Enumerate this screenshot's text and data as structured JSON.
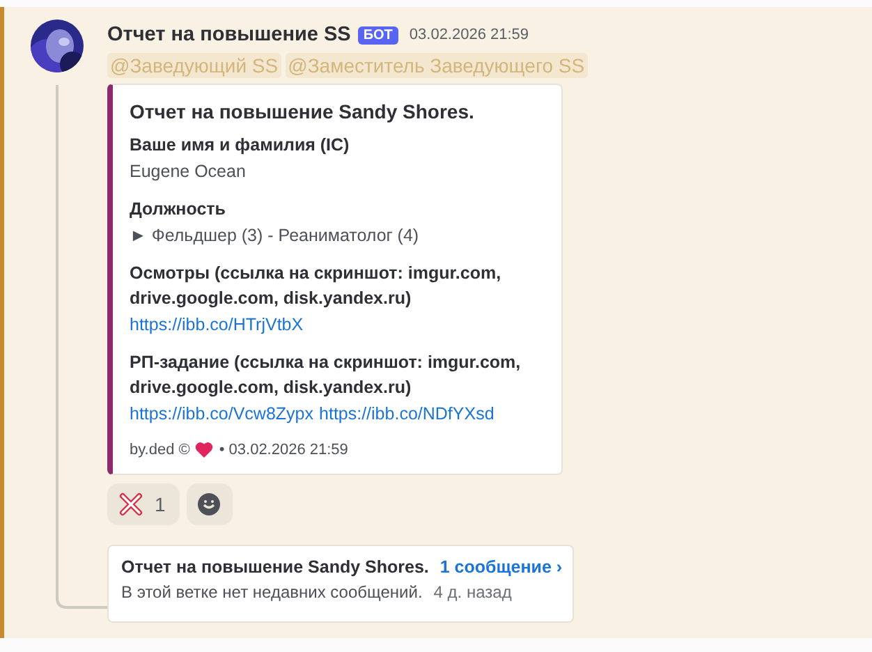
{
  "message": {
    "author": "Отчет на повышение SS",
    "badge": "БОТ",
    "timestamp": "03.02.2026 21:59",
    "mentions": [
      "@Заведующий SS",
      "@Заместитель Заведующего SS"
    ],
    "embed": {
      "title": "Отчет на повышение Sandy Shores.",
      "fields": [
        {
          "name": "Ваше имя и фамилия (IC)",
          "values": [
            {
              "kind": "text",
              "text": "Eugene Ocean"
            }
          ]
        },
        {
          "name": "Должность",
          "values": [
            {
              "kind": "text",
              "text": "► Фельдшер (3) - Реаниматолог (4)"
            }
          ]
        },
        {
          "name": "Осмотры (ссылка на скриншот: imgur.com, drive.google.com, disk.yandex.ru)",
          "values": [
            {
              "kind": "link",
              "text": "https://ibb.co/HTrjVtbX"
            }
          ]
        },
        {
          "name": "РП-задание   (ссылка на скриншот: imgur.com, drive.google.com, disk.yandex.ru)",
          "values": [
            {
              "kind": "link",
              "text": "https://ibb.co/Vcw8Zypx"
            },
            {
              "kind": "link",
              "text": "https://ibb.co/NDfYXsd"
            }
          ]
        }
      ],
      "footer": {
        "text": "by.ded ©",
        "timestamp": "• 03.02.2026 21:59"
      }
    },
    "reactions": [
      {
        "kind": "emoji",
        "count": "1"
      },
      {
        "kind": "add"
      }
    ],
    "thread": {
      "title": "Отчет на повышение Sandy Shores.",
      "link": "1 сообщение ›",
      "subtitle": "В этой ветке нет недавних сообщений.",
      "age": "4 д. назад"
    }
  }
}
